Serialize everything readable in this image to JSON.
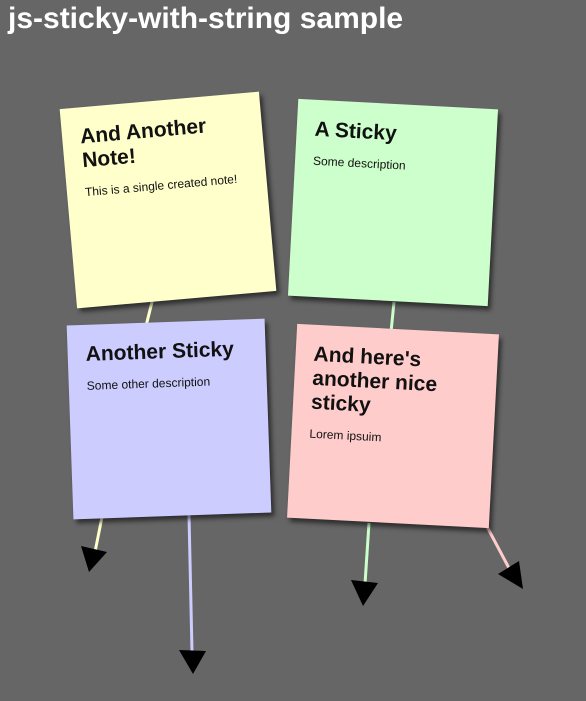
{
  "page": {
    "title": "js-sticky-with-string sample",
    "background": "#666666"
  },
  "notes": [
    {
      "title": "And Another Note!",
      "description": "This is a single created note!",
      "color": "#ffffcc",
      "string_color": "#ffffcc"
    },
    {
      "title": "A Sticky",
      "description": "Some description",
      "color": "#ccffcc",
      "string_color": "#ccffcc"
    },
    {
      "title": "Another Sticky",
      "description": "Some other description",
      "color": "#ccccff",
      "string_color": "#ccccff"
    },
    {
      "title": "And here's another nice sticky",
      "description": "Lorem ipsuim",
      "color": "#ffcccc",
      "string_color": "#ffcccc"
    }
  ]
}
